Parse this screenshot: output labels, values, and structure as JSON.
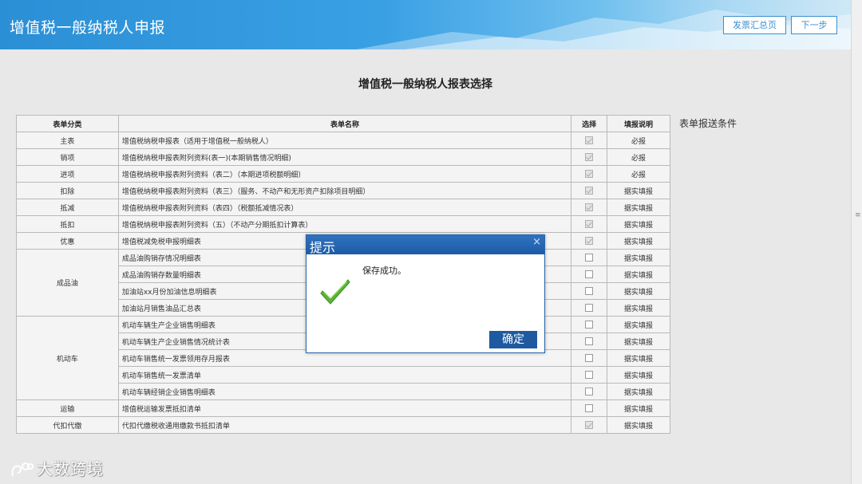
{
  "header": {
    "title": "增值税一般纳税人申报",
    "btn_summary": "发票汇总页",
    "btn_next": "下一步"
  },
  "page": {
    "title": "增值税一般纳税人报表选择",
    "side_condition": "表单报送条件"
  },
  "table": {
    "headers": [
      "表单分类",
      "表单名称",
      "选择",
      "填报说明"
    ],
    "rows": [
      {
        "category": "主表",
        "name": "增值税纳税申报表（适用于增值税一般纳税人）",
        "checked": true,
        "note": "必报"
      },
      {
        "category": "销项",
        "name": "增值税纳税申报表附列资料(表一)(本期销售情况明细)",
        "checked": true,
        "note": "必报"
      },
      {
        "category": "进项",
        "name": "增值税纳税申报表附列资料（表二）（本期进项税额明细）",
        "checked": true,
        "note": "必报"
      },
      {
        "category": "扣除",
        "name": "增值税纳税申报表附列资料（表三）（服务、不动产和无形资产扣除项目明细）",
        "checked": true,
        "note": "据实填报"
      },
      {
        "category": "抵减",
        "name": "增值税纳税申报表附列资料（表四）（税额抵减情况表）",
        "checked": true,
        "note": "据实填报"
      },
      {
        "category": "抵扣",
        "name": "增值税纳税申报表附列资料（五）（不动产分期抵扣计算表）",
        "checked": true,
        "note": "据实填报"
      },
      {
        "category": "优惠",
        "name": "增值税减免税申报明细表",
        "checked": true,
        "note": "据实填报"
      },
      {
        "category": "成品油",
        "name": "成品油购销存情况明细表",
        "checked": false,
        "note": "据实填报"
      },
      {
        "category": "",
        "name": "成品油购销存数量明细表",
        "checked": false,
        "note": "据实填报"
      },
      {
        "category": "",
        "name": "加油站xx月份加油信息明细表",
        "checked": false,
        "note": "据实填报"
      },
      {
        "category": "",
        "name": "加油站月销售油品汇总表",
        "checked": false,
        "note": "据实填报"
      },
      {
        "category": "机动车",
        "name": "机动车辆生产企业销售明细表",
        "checked": false,
        "note": "据实填报"
      },
      {
        "category": "",
        "name": "机动车辆生产企业销售情况统计表",
        "checked": false,
        "note": "据实填报"
      },
      {
        "category": "",
        "name": "机动车销售统一发票领用存月报表",
        "checked": false,
        "note": "据实填报"
      },
      {
        "category": "",
        "name": "机动车销售统一发票清单",
        "checked": false,
        "note": "据实填报"
      },
      {
        "category": "",
        "name": "机动车辆经销企业销售明细表",
        "checked": false,
        "note": "据实填报"
      },
      {
        "category": "运输",
        "name": "增值税运输发票抵扣清单",
        "checked": false,
        "note": "据实填报"
      },
      {
        "category": "代扣代缴",
        "name": "代扣代缴税收通用缴款书抵扣清单",
        "checked": true,
        "note": "据实填报"
      }
    ]
  },
  "dialog": {
    "title": "提示",
    "message": "保存成功。",
    "ok_label": "确定",
    "close_glyph": "×"
  },
  "watermark": "大数跨境",
  "colors": {
    "header": "#2b8fd6",
    "dialog_header": "#1e5aa6",
    "ok_button": "#1f5aa0"
  }
}
